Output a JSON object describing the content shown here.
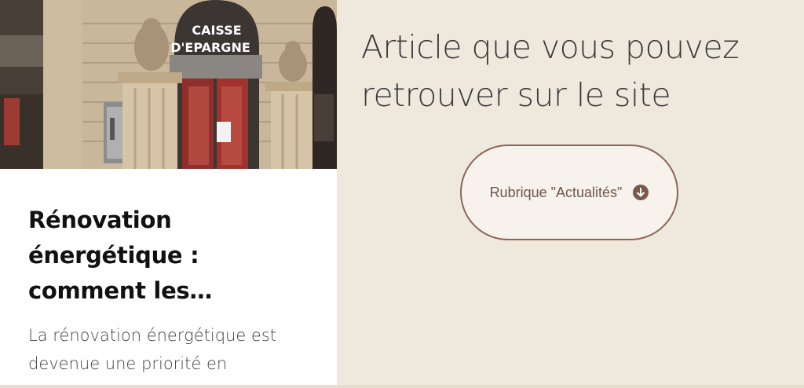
{
  "article_card": {
    "image_sign_line1": "CAISSE",
    "image_sign_line2": "D'EPARGNE",
    "title": "Rénovation énergétique : comment les…",
    "excerpt": "La rénovation énergétique est devenue une priorité en"
  },
  "right_panel": {
    "headline": "Article que vous pouvez retrouver sur le site",
    "button_label": "Rubrique \"Actualités\"",
    "button_icon": "arrow-down-circle-icon"
  },
  "colors": {
    "page_background": "#efe9dd",
    "card_background": "#ffffff",
    "button_border": "#8a6656",
    "button_background": "#f7f2ec",
    "button_icon": "#7a5a4a"
  }
}
